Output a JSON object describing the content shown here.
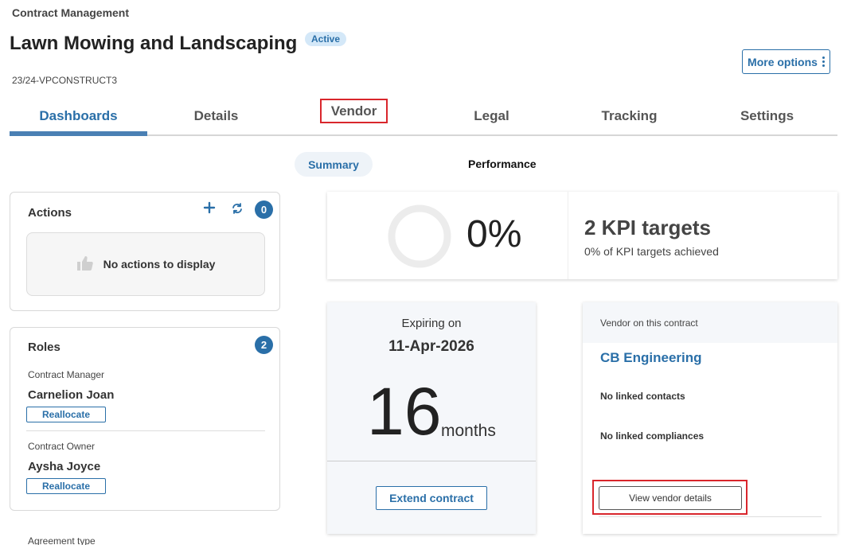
{
  "breadcrumb": "Contract Management",
  "title": "Lawn Mowing and Landscaping",
  "status": "Active",
  "contract_code": "23/24-VPCONSTRUCT3",
  "more_options": "More options",
  "tabs": [
    {
      "label": "Dashboards"
    },
    {
      "label": "Details"
    },
    {
      "label": "Vendor"
    },
    {
      "label": "Legal"
    },
    {
      "label": "Tracking"
    },
    {
      "label": "Settings"
    }
  ],
  "subtabs": {
    "summary": "Summary",
    "performance": "Performance"
  },
  "actions": {
    "title": "Actions",
    "count": "0",
    "empty": "No actions to display"
  },
  "roles": {
    "title": "Roles",
    "count": "2",
    "items": [
      {
        "role": "Contract Manager",
        "name": "Carnelion Joan",
        "button": "Reallocate"
      },
      {
        "role": "Contract Owner",
        "name": "Aysha Joyce",
        "button": "Reallocate"
      }
    ]
  },
  "agreement_type_label": "Agreement type",
  "kpi": {
    "percent": "0%",
    "progress": 0,
    "targets": "2 KPI targets",
    "achieved": "0% of KPI targets achieved"
  },
  "expiry": {
    "label": "Expiring on",
    "date": "11-Apr-2026",
    "number": "16",
    "unit": "months",
    "button": "Extend contract"
  },
  "vendor": {
    "header": "Vendor on this contract",
    "name": "CB Engineering",
    "contacts": "No linked contacts",
    "compliances": "No linked compliances",
    "button": "View vendor details"
  },
  "colors": {
    "accent": "#2a6fa8",
    "highlight": "#d9262c",
    "badge_bg": "#d4e8f8"
  }
}
